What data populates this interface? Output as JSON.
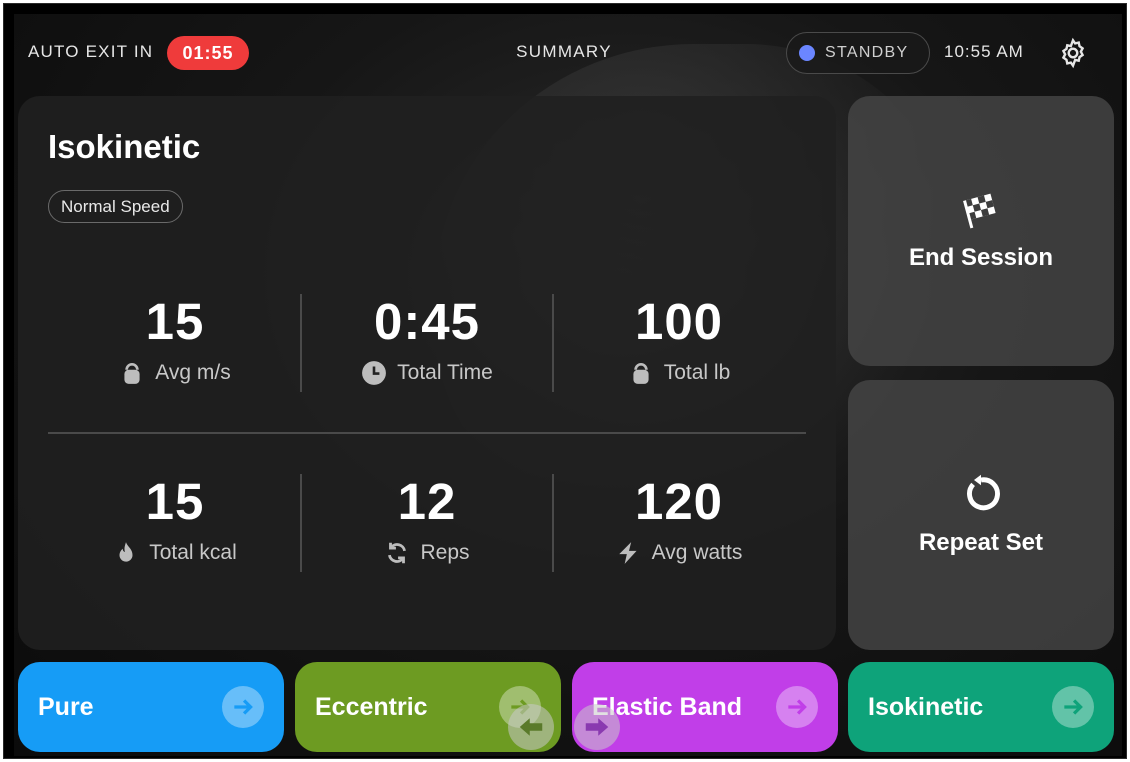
{
  "topbar": {
    "auto_exit_label": "AUTO EXIT IN",
    "countdown": "01:55",
    "title": "SUMMARY",
    "status": "STANDBY",
    "time": "10:55 AM",
    "settings_icon": "gear-icon"
  },
  "summary": {
    "mode_title": "Isokinetic",
    "speed_badge": "Normal Speed",
    "stats": [
      {
        "value": "15",
        "label": "Avg m/s",
        "icon": "kettlebell-icon"
      },
      {
        "value": "0:45",
        "label": "Total Time",
        "icon": "clock-icon"
      },
      {
        "value": "100",
        "label": "Total lb",
        "icon": "kettlebell-icon"
      },
      {
        "value": "15",
        "label": "Total kcal",
        "icon": "flame-icon"
      },
      {
        "value": "12",
        "label": "Reps",
        "icon": "repeat-icon"
      },
      {
        "value": "120",
        "label": "Avg watts",
        "icon": "lightning-icon"
      }
    ]
  },
  "actions": {
    "end_session": {
      "label": "End Session",
      "icon": "checkered-flag-icon"
    },
    "repeat_set": {
      "label": "Repeat Set",
      "icon": "restart-icon"
    }
  },
  "modes": [
    {
      "label": "Pure",
      "color": "#169cf6"
    },
    {
      "label": "Eccentric",
      "color": "#6d9b22"
    },
    {
      "label": "Elastic Band",
      "color": "#c13ee8"
    },
    {
      "label": "Isokinetic",
      "color": "#0ea37a"
    }
  ],
  "colors": {
    "countdown_bg": "#ef3b3b",
    "standby_dot": "#6b86ff"
  }
}
